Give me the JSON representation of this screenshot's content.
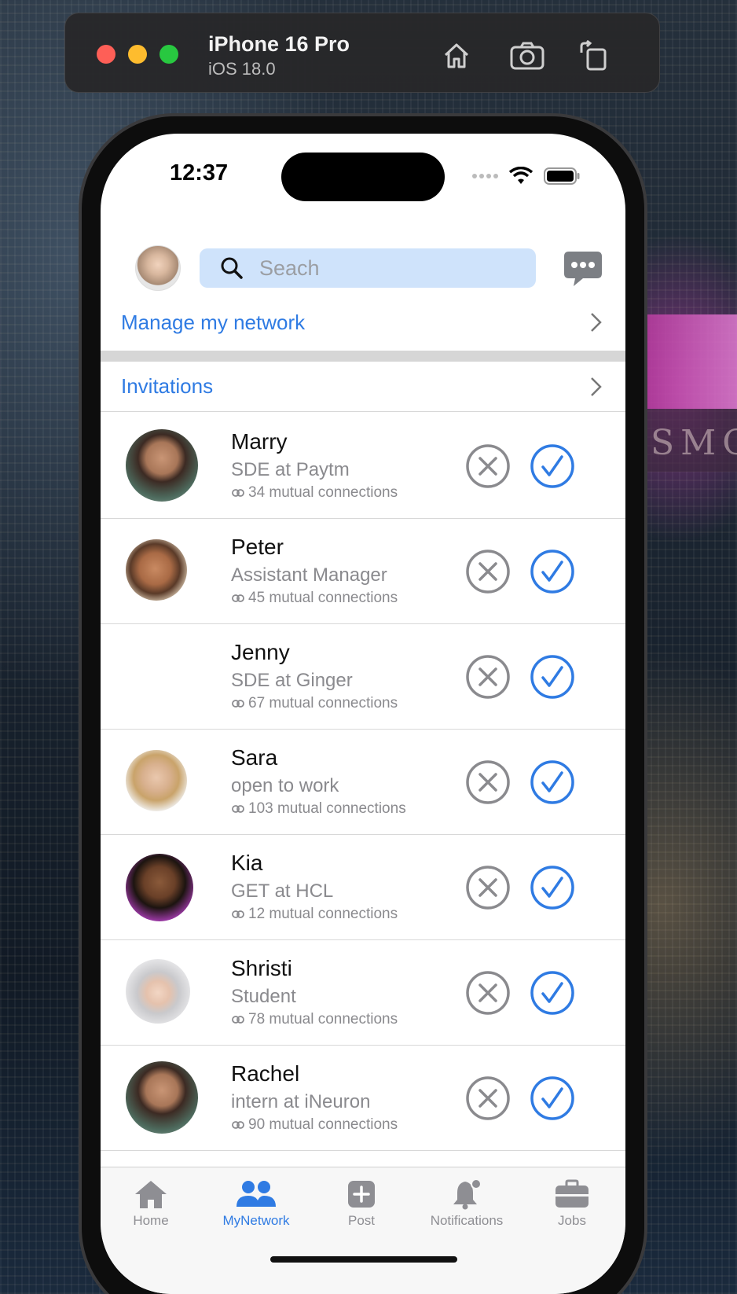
{
  "simulator": {
    "device": "iPhone 16 Pro",
    "os": "iOS 18.0",
    "buttons": [
      "home-icon",
      "screenshot-icon",
      "rotate-icon"
    ]
  },
  "status_bar": {
    "time": "12:37"
  },
  "header": {
    "search_placeholder": "Seach"
  },
  "links": {
    "manage": "Manage my network",
    "invitations": "Invitations"
  },
  "invitations": [
    {
      "name": "Marry",
      "title": "SDE at Paytm",
      "mutual": "34 mutual connections"
    },
    {
      "name": "Peter",
      "title": "Assistant Manager",
      "mutual": "45 mutual connections"
    },
    {
      "name": "Jenny",
      "title": "SDE at Ginger",
      "mutual": "67 mutual connections"
    },
    {
      "name": "Sara",
      "title": "open to work",
      "mutual": "103 mutual connections"
    },
    {
      "name": "Kia",
      "title": "GET at HCL",
      "mutual": "12 mutual connections"
    },
    {
      "name": "Shristi",
      "title": "Student",
      "mutual": "78 mutual connections"
    },
    {
      "name": "Rachel",
      "title": "intern at iNeuron",
      "mutual": "90 mutual connections"
    }
  ],
  "tabs": [
    {
      "label": "Home",
      "icon": "home-icon"
    },
    {
      "label": "MyNetwork",
      "icon": "people-icon",
      "active": true
    },
    {
      "label": "Post",
      "icon": "plus-square-icon"
    },
    {
      "label": "Notifications",
      "icon": "bell-icon"
    },
    {
      "label": "Jobs",
      "icon": "briefcase-icon"
    }
  ],
  "colors": {
    "accent": "#2f7be3",
    "search_bg": "#cfe3fb",
    "decline": "#8a8a8e",
    "separator": "#d6d6d6"
  }
}
